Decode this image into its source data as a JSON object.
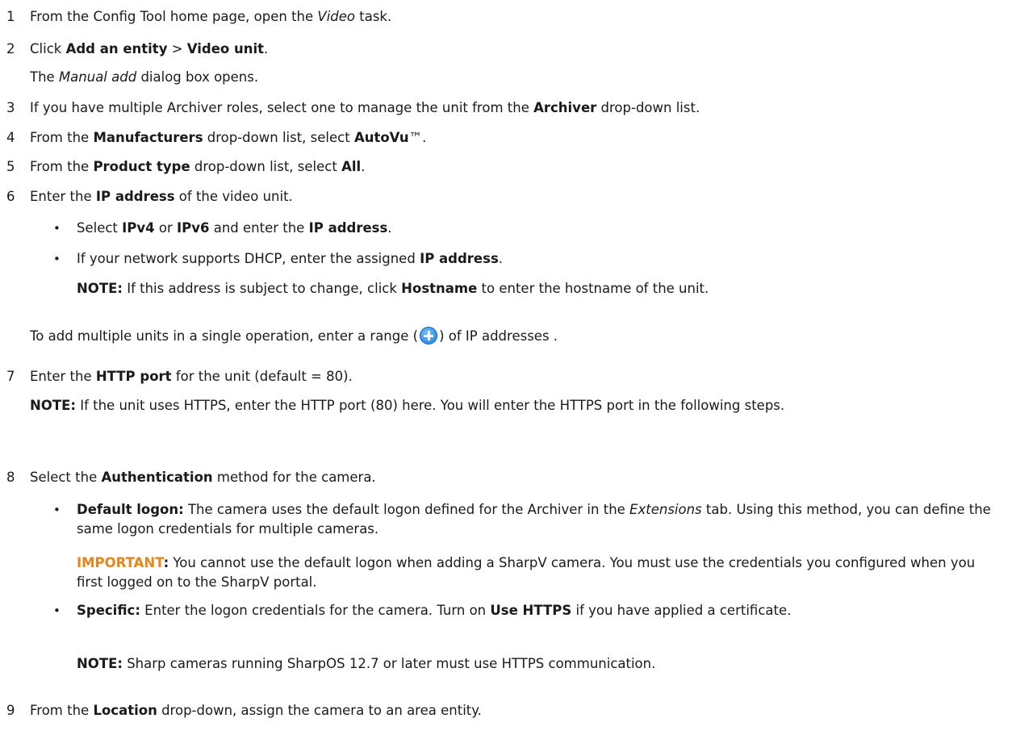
{
  "doc": {
    "step1": {
      "n": "1",
      "a": "From the Config Tool home page, open the ",
      "task": "Video",
      "b": " task."
    },
    "step2": {
      "n": "2",
      "a": "Click ",
      "add": "Add an entity",
      "sep": " > ",
      "unit": "Video unit",
      "end": ".",
      "note_dialog": "Manual add",
      "note_rest": " dialog box opens.",
      "note_the": "The "
    },
    "step3": {
      "n": "3",
      "a": "If you have multiple Archiver roles, select one to manage the unit from the ",
      "archiver": "Archiver",
      "b": " drop-down list."
    },
    "step4": {
      "n": "4",
      "a": "From the ",
      "manufacturers": "Manufacturers",
      "b": " drop-down list, select ",
      "autovu": "AutoVu",
      "tm": "™",
      "end": "."
    },
    "step5": {
      "n": "5",
      "a": "From the ",
      "ptype": "Product type",
      "b": " drop-down list, select ",
      "all": "All",
      "end": "."
    },
    "step6": {
      "n": "6",
      "a": "Enter the ",
      "ip": "IP address",
      "b": " of the video unit.",
      "bullet1": {
        "a": "Select ",
        "ipv4": "IPv4",
        "or": " or ",
        "ipv6": "IPv6",
        "b": " and enter the ",
        "ip": "IP address",
        "end": "."
      },
      "bullet2": {
        "a": "If your network supports DHCP, enter the assigned ",
        "ip": "IP address",
        "end": "."
      },
      "note": {
        "label": "NOTE:",
        "a": "  If this address is subject to change, click ",
        "hostname": "Hostname",
        "b": " to enter the hostname of the unit."
      },
      "range": {
        "a": "To add multiple units in a single operation, enter a range (",
        "b": ") of IP addresses ."
      }
    },
    "step7": {
      "n": "7",
      "a": "Enter the ",
      "port": "HTTP port",
      "b": " for the unit (default = 80).",
      "note": {
        "label": "NOTE:",
        "text": "  If the unit uses HTTPS, enter the HTTP port (80) here. You will enter the HTTPS port in the following steps."
      }
    },
    "step8": {
      "n": "8",
      "a": "Select the ",
      "auth": "Authentication",
      "b": " method for the camera.",
      "bullet1": {
        "label": "Default logon:",
        "a": " The camera uses the default logon defined for the Archiver in the ",
        "tab": "Extensions",
        "b": " tab. Using this method, you can define the same logon credentials for multiple cameras."
      },
      "important": {
        "label": "IMPORTANT",
        "colon": ":",
        "text": "  You cannot use the default logon when adding a SharpV camera. You must use the credentials you configured when you first logged on to the SharpV portal."
      },
      "bullet2": {
        "label": "Specific:",
        "a": " Enter the logon credentials for the camera. Turn on ",
        "https": "Use HTTPS",
        "b": " if you have applied a certificate."
      },
      "note": {
        "label": "NOTE:",
        "text": "  Sharp cameras running SharpOS 12.7 or later must use HTTPS communication."
      }
    },
    "step9": {
      "n": "9",
      "a": "From the ",
      "location": "Location",
      "b": " drop-down, assign the camera to an area entity."
    }
  },
  "icons": {
    "range_add": "plus-circle-icon"
  },
  "colors": {
    "important": "#e8841b",
    "icon": "#1d7fd9"
  }
}
